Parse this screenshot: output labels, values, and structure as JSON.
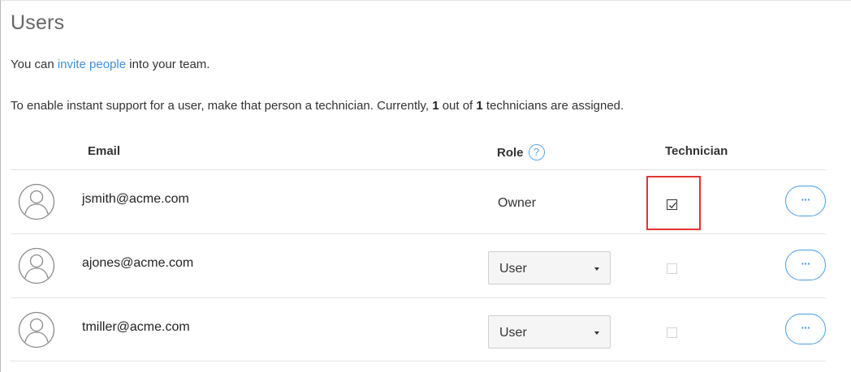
{
  "page": {
    "title": "Users",
    "intro_prefix": "You can ",
    "intro_link": "invite people",
    "intro_suffix": " into your team.",
    "support_prefix": "To enable instant support for a user, make that person a technician. Currently, ",
    "support_assigned": "1",
    "support_middle": " out of ",
    "support_total": "1",
    "support_suffix": " technicians are assigned."
  },
  "table": {
    "headers": {
      "email": "Email",
      "role": "Role",
      "technician": "Technician"
    },
    "rows": [
      {
        "email": "jsmith@acme.com",
        "role": "Owner",
        "role_editable": false,
        "technician": true,
        "more": "···"
      },
      {
        "email": "ajones@acme.com",
        "role": "User",
        "role_editable": true,
        "technician": false,
        "more": "···"
      },
      {
        "email": "tmiller@acme.com",
        "role": "User",
        "role_editable": true,
        "technician": false,
        "more": "···"
      }
    ]
  },
  "icons": {
    "role_help": "question-circle-icon",
    "avatar": "user-avatar-icon",
    "role_dropdown": "caret-down-icon",
    "row_menu": "more-horizontal-icon"
  },
  "colors": {
    "link": "#3f8fd8",
    "accent": "#4a9de2",
    "highlight": "#e23333"
  }
}
